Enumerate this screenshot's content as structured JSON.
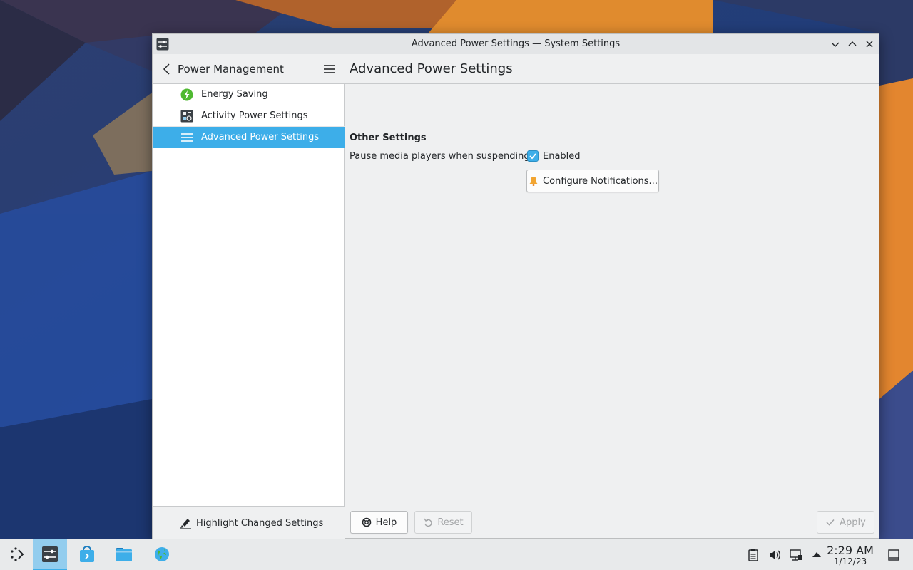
{
  "window": {
    "title": "Advanced Power Settings — System Settings"
  },
  "sidebar": {
    "title": "Power Management",
    "items": [
      {
        "label": "Energy Saving",
        "icon": "energy-saving-icon"
      },
      {
        "label": "Activity Power Settings",
        "icon": "activity-icon"
      },
      {
        "label": "Advanced Power Settings",
        "icon": "list-icon",
        "selected": true
      }
    ],
    "footer_button": "Highlight Changed Settings"
  },
  "main": {
    "title": "Advanced Power Settings",
    "section_title": "Other Settings",
    "pause_label": "Pause media players when suspending:",
    "pause_checkbox_label": "Enabled",
    "pause_checked": true,
    "configure_button": "Configure Notifications..."
  },
  "buttons": {
    "help": "Help",
    "reset": "Reset",
    "apply": "Apply"
  },
  "taskbar": {
    "time": "2:29 AM",
    "date": "1/12/23"
  },
  "colors": {
    "accent": "#3daee9",
    "window_bg": "#eff0f1"
  }
}
